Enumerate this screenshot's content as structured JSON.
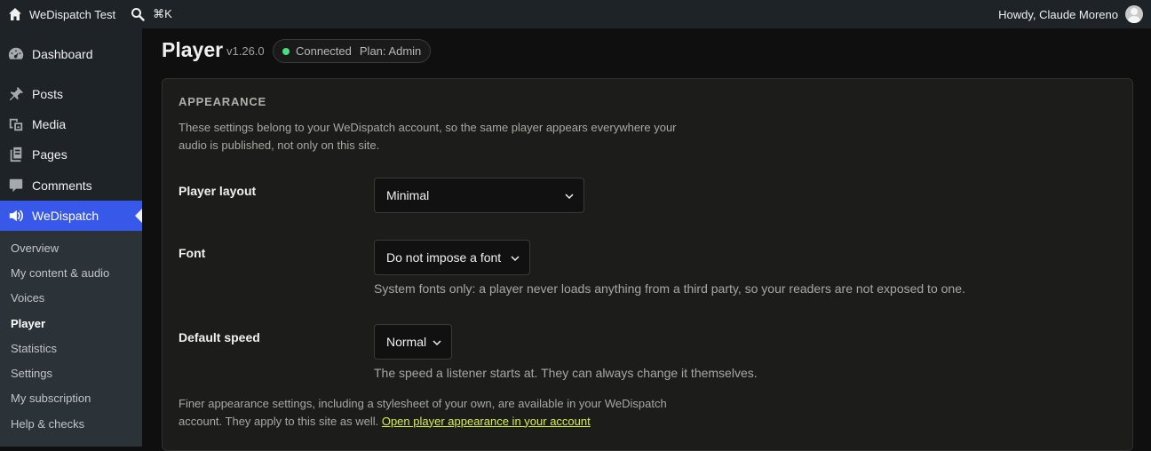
{
  "adminbar": {
    "site_name": "WeDispatch Test",
    "search_shortcut": "⌘K",
    "greeting": "Howdy, Claude Moreno"
  },
  "sidebar": {
    "items": [
      {
        "label": "Dashboard",
        "icon": "dashboard-icon"
      },
      {
        "label": "Posts",
        "icon": "pin-icon"
      },
      {
        "label": "Media",
        "icon": "media-icon"
      },
      {
        "label": "Pages",
        "icon": "pages-icon"
      },
      {
        "label": "Comments",
        "icon": "comment-icon"
      },
      {
        "label": "WeDispatch",
        "icon": "speaker-icon",
        "active": true
      }
    ],
    "submenu": [
      {
        "label": "Overview"
      },
      {
        "label": "My content & audio"
      },
      {
        "label": "Voices"
      },
      {
        "label": "Player",
        "current": true
      },
      {
        "label": "Statistics"
      },
      {
        "label": "Settings"
      },
      {
        "label": "My subscription"
      },
      {
        "label": "Help & checks"
      }
    ]
  },
  "page": {
    "title": "Player",
    "version": "v1.26.0",
    "status": "Connected",
    "plan": "Plan: Admin",
    "status_color": "#4ade80"
  },
  "card": {
    "heading": "APPEARANCE",
    "description": "These settings belong to your WeDispatch account, so the same player appears everywhere your audio is published, not only on this site.",
    "fields": {
      "layout": {
        "label": "Player layout",
        "value": "Minimal"
      },
      "font": {
        "label": "Font",
        "value": "Do not impose a font",
        "help": "System fonts only: a player never loads anything from a third party, so your readers are not exposed to one."
      },
      "speed": {
        "label": "Default speed",
        "value": "Normal",
        "help": "The speed a listener starts at. They can always change it themselves."
      }
    },
    "footer_text": "Finer appearance settings, including a stylesheet of your own, are available in your WeDispatch account. They apply to this site as well.",
    "footer_link": "Open player appearance in your account",
    "link_color": "#d9f04a"
  }
}
